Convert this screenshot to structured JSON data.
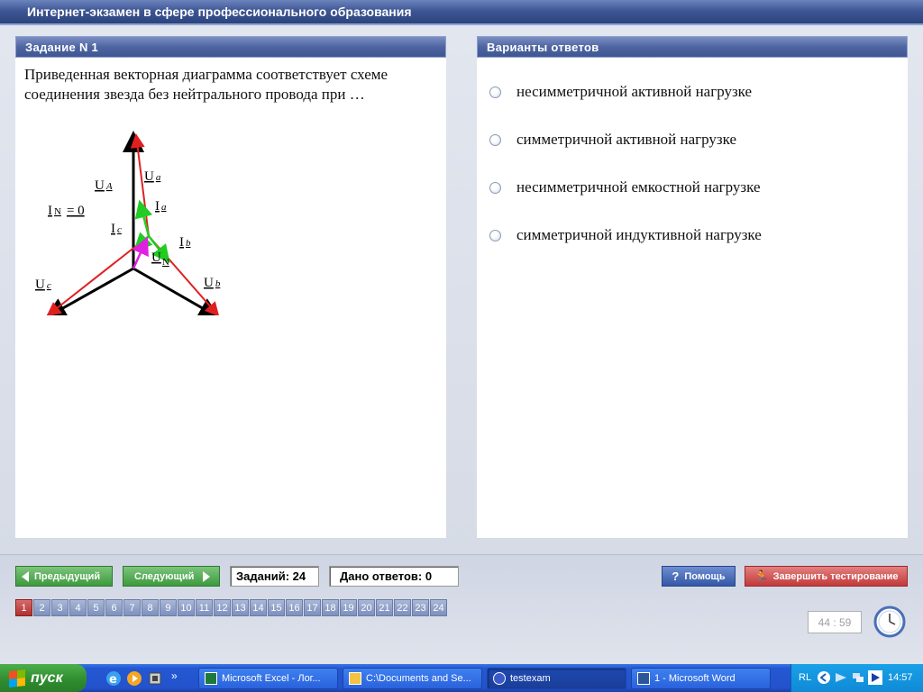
{
  "window": {
    "title": "Интернет-экзамен в сфере профессионального образования"
  },
  "task": {
    "header": "Задание N 1",
    "question": "Приведенная векторная диаграмма соответствует схеме соединения звезда без нейтрального провода при …",
    "diagram_labels": {
      "ua_cap": "U",
      "ua_sub": "A",
      "ua_small": "U",
      "ua_small_sub": "a",
      "ia": "I",
      "ia_sub": "a",
      "in_label": "I",
      "in_sub": "N",
      "in_eq": "= 0",
      "ic": "I",
      "ic_sub": "c",
      "ib": "I",
      "ib_sub": "b",
      "un": "U",
      "un_sub": "N",
      "uc_small": "U",
      "uc_small_sub": "c",
      "ub_small": "U",
      "ub_small_sub": "b",
      "uc_cap": "U",
      "uc_cap_sub": "C",
      "ub_cap": "U",
      "ub_cap_sub": "B"
    }
  },
  "answers": {
    "header": "Варианты ответов",
    "options": [
      "несимметричной активной нагрузке",
      "симметричной активной нагрузке",
      "несимметричной емкостной нагрузке",
      "симметричной индуктивной нагрузке"
    ]
  },
  "nav": {
    "prev_label": "Предыдущий",
    "next_label": "Следующий",
    "tasks_count": "Заданий: 24",
    "answers_count": "Дано ответов: 0",
    "help_label": "Помощь",
    "finish_label": "Завершить тестирование",
    "task_numbers": [
      "1",
      "2",
      "3",
      "4",
      "5",
      "6",
      "7",
      "8",
      "9",
      "10",
      "11",
      "12",
      "13",
      "14",
      "15",
      "16",
      "17",
      "18",
      "19",
      "20",
      "21",
      "22",
      "23",
      "24"
    ],
    "active_task": "1",
    "timer": "44 : 59"
  },
  "taskbar": {
    "start_label": "пуск",
    "items": [
      "Microsoft Excel - Лог...",
      "C:\\Documents and Se...",
      "testexam",
      "1 - Microsoft Word"
    ],
    "lang": "RL",
    "time": "14:57"
  },
  "colors": {
    "title_bar": "#3e5694",
    "panel_header": "#4e65a2",
    "nav_green": "#3d9a3d",
    "help_blue": "#3358a8",
    "finish_red": "#c23a3a",
    "active_task": "#b03030",
    "vector_red": "#e02020",
    "vector_green": "#22cc22",
    "vector_magenta": "#e020e0"
  }
}
